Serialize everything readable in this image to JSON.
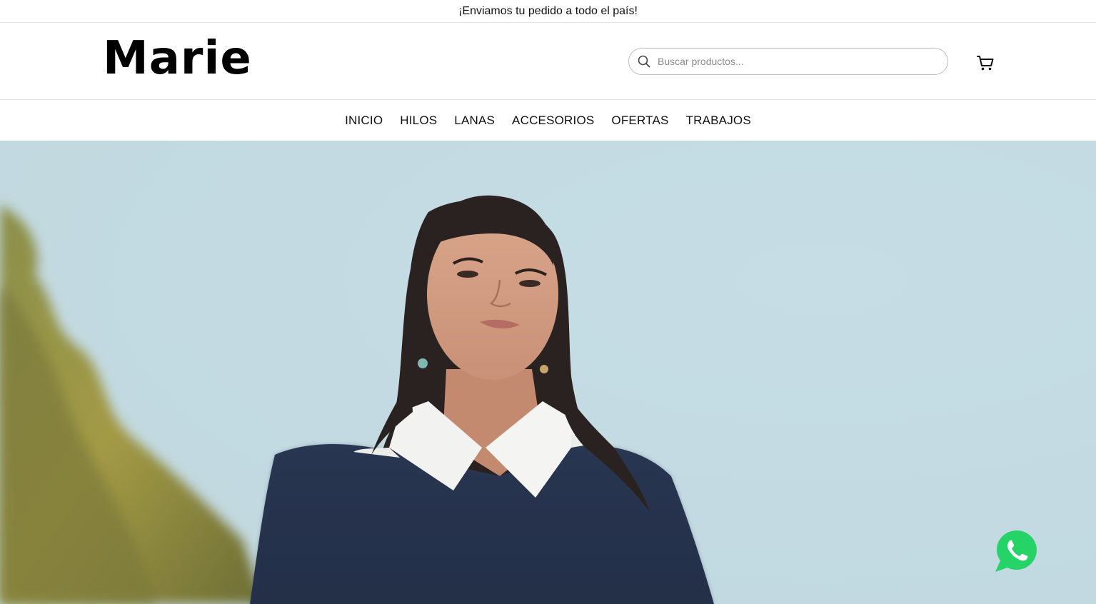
{
  "announcement": {
    "text": "¡Enviamos tu pedido a todo el país!"
  },
  "header": {
    "logo_text": "Marie",
    "search": {
      "placeholder": "Buscar productos...",
      "value": "",
      "icon": "search-icon"
    },
    "cart": {
      "icon": "cart-icon"
    }
  },
  "nav": {
    "items": [
      {
        "label": "INICIO"
      },
      {
        "label": "HILOS"
      },
      {
        "label": "LANAS"
      },
      {
        "label": "ACCESORIOS"
      },
      {
        "label": "OFERTAS"
      },
      {
        "label": "TRABAJOS"
      }
    ]
  },
  "hero": {
    "image": "hero-banner-image"
  },
  "whatsapp": {
    "icon": "whatsapp-icon",
    "color": "#25d366"
  },
  "colors": {
    "text": "#111111",
    "border": "#e2e2e2",
    "sky": "#c5dce4"
  }
}
